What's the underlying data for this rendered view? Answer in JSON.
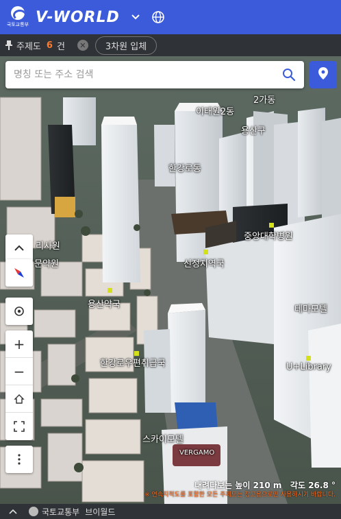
{
  "header": {
    "emblem_label": "국토교통부",
    "logo": "V-WORLD"
  },
  "topic_bar": {
    "label": "주제도",
    "count": "6",
    "unit": "건",
    "chip": "3차원 입체"
  },
  "search": {
    "placeholder": "명칭 또는 주소 검색"
  },
  "map_labels": [
    "이태원2동",
    "한강로동",
    "용산구",
    "중앙대학병원",
    "신정지역국",
    "테마모텔",
    "U+Library",
    "용산약국",
    "한강로우편취급국",
    "스카이모텔",
    "VERGAMO",
    "리사원",
    "문약원",
    "2가동"
  ],
  "controls": {
    "zoom_in": "+",
    "zoom_out": "−"
  },
  "status": {
    "height_label": "내려다보는 높이",
    "height_value": "210 m",
    "angle_label": "각도",
    "angle_value": "26.8 °",
    "warning": "※ 연속지적도를 포함한 모든 주제도는 참고용으로만 사용하시기 바랍니다."
  },
  "footer": {
    "org": "국토교통부",
    "brand": "브이월드"
  }
}
